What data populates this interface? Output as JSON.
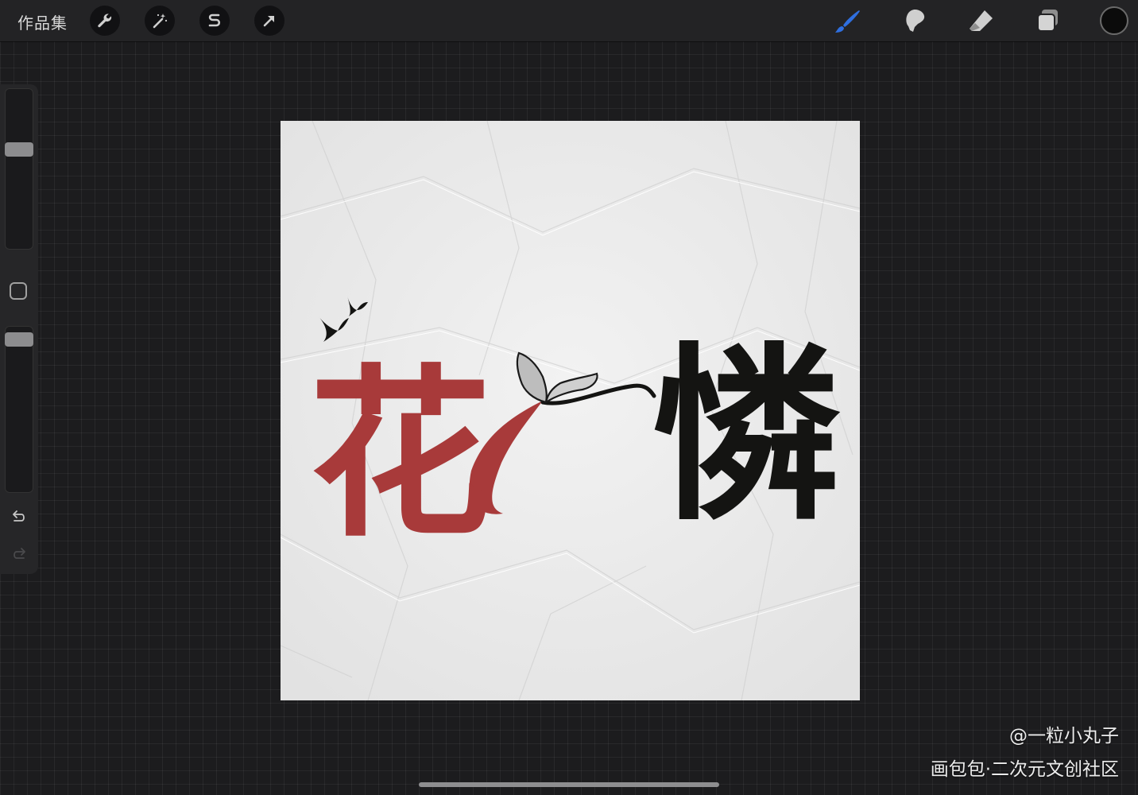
{
  "topbar": {
    "gallery_label": "作品集",
    "left_tools": [
      "wrench-icon",
      "magic-wand-icon",
      "selection-icon",
      "transform-arrow-icon"
    ],
    "right_tools": [
      "brush-icon",
      "smudge-icon",
      "eraser-icon",
      "layers-icon"
    ],
    "active_tool": "brush",
    "accent_color": "#2f6fe0",
    "current_color": "#0b0b0b"
  },
  "sidebar": {
    "brush_size": 0.63,
    "brush_opacity": 0.96,
    "undo_icon": "undo-arrow-icon",
    "redo_icon": "redo-arrow-icon"
  },
  "artwork": {
    "red_character": "花",
    "black_character": "憐",
    "red_color": "#a83a3a",
    "ink_color": "#141412"
  },
  "watermark": {
    "author": "@一粒小丸子",
    "site": "画包包·二次元文创社区"
  }
}
